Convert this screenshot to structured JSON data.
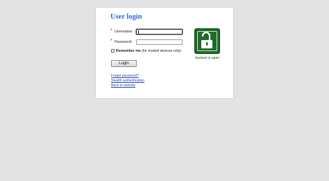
{
  "login": {
    "title": "User login",
    "username_label": "Username:",
    "password_label": "Password:",
    "username_value": "",
    "password_value": "",
    "remember_bold": "Remember me",
    "remember_note": "(for trusted devices only)",
    "login_button": "Login",
    "links": {
      "forgot_password": "Forgot password?",
      "stealth_auth": "Stealth authentication",
      "back_to_website": "Back to website"
    },
    "status": {
      "text": "System is open",
      "icon": "open-padlock-icon"
    }
  },
  "colors": {
    "page_bg": "#e3e3e3",
    "title": "#2a6ccf",
    "required_marker": "#d40000",
    "link": "#2646b5",
    "status_green": "#1f7a2a"
  }
}
